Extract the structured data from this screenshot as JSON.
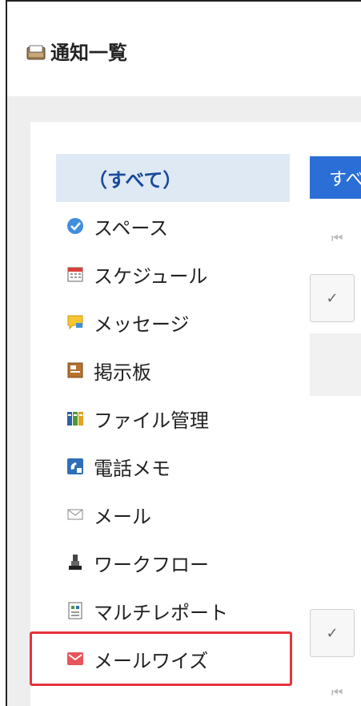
{
  "header": {
    "title": "通知一覧"
  },
  "sidebar": {
    "items": [
      {
        "label": "（すべて）",
        "icon": "none"
      },
      {
        "label": "スペース",
        "icon": "space-icon"
      },
      {
        "label": "スケジュール",
        "icon": "calendar-icon"
      },
      {
        "label": "メッセージ",
        "icon": "message-icon"
      },
      {
        "label": "掲示板",
        "icon": "bulletin-board-icon"
      },
      {
        "label": "ファイル管理",
        "icon": "file-management-icon"
      },
      {
        "label": "電話メモ",
        "icon": "phone-memo-icon"
      },
      {
        "label": "メール",
        "icon": "mail-icon"
      },
      {
        "label": "ワークフロー",
        "icon": "workflow-icon"
      },
      {
        "label": "マルチレポート",
        "icon": "multi-report-icon"
      },
      {
        "label": "メールワイズ",
        "icon": "mailwise-icon"
      }
    ]
  },
  "main": {
    "tab_label": "すべ",
    "first_page_glyph": "⏮",
    "check_glyph": "✓"
  },
  "colors": {
    "accent": "#2b6fd6",
    "selected_bg": "#dfe9f4",
    "highlight": "#e5333b"
  }
}
